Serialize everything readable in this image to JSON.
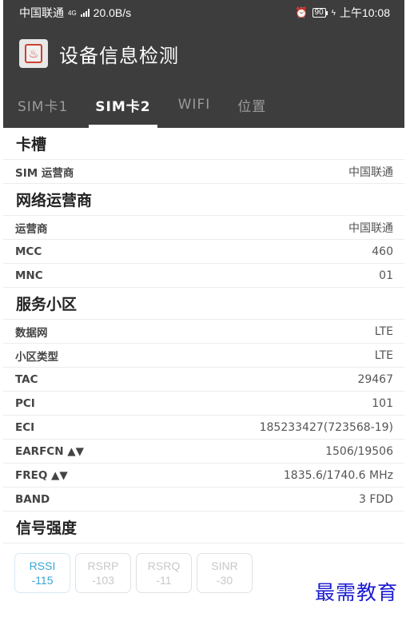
{
  "status_bar": {
    "carrier": "中国联通",
    "net_type": "4G",
    "speed": "20.0B/s",
    "alarm_icon": "alarm-icon",
    "battery": "90",
    "time": "上午10:08"
  },
  "header": {
    "app_icon": "app-icon",
    "title": "设备信息检测"
  },
  "tabs": [
    {
      "label": "SIM卡1"
    },
    {
      "label": "SIM卡2"
    },
    {
      "label": "WIFI"
    },
    {
      "label": "位置"
    }
  ],
  "active_tab": 1,
  "sections": [
    {
      "title": "卡槽",
      "rows": [
        {
          "key": "SIM 运营商",
          "value": "中国联通"
        }
      ]
    },
    {
      "title": "网络运营商",
      "rows": [
        {
          "key": "运营商",
          "value": "中国联通"
        },
        {
          "key": "MCC",
          "value": "460"
        },
        {
          "key": "MNC",
          "value": "01"
        }
      ]
    },
    {
      "title": "服务小区",
      "rows": [
        {
          "key": "数据网",
          "value": "LTE"
        },
        {
          "key": "小区类型",
          "value": "LTE"
        },
        {
          "key": "TAC",
          "value": "29467"
        },
        {
          "key": "PCI",
          "value": "101"
        },
        {
          "key": "ECI",
          "value": "185233427(723568-19)"
        },
        {
          "key": "EARFCN ▲▼",
          "value": "1506/19506"
        },
        {
          "key": "FREQ ▲▼",
          "value": "1835.6/1740.6 MHz"
        },
        {
          "key": "BAND",
          "value": "3 FDD"
        }
      ]
    },
    {
      "title": "信号强度",
      "rows": []
    }
  ],
  "signal_chips": [
    {
      "name": "RSSI",
      "value": "-115",
      "active": true
    },
    {
      "name": "RSRP",
      "value": "-103",
      "active": false
    },
    {
      "name": "RSRQ",
      "value": "-11",
      "active": false
    },
    {
      "name": "SINR",
      "value": "-30",
      "active": false
    }
  ],
  "watermark": "最需教育",
  "colors": {
    "bar_bg": "#3d3d3d",
    "accent_blue": "#39a5d8",
    "watermark": "#1b1bd0"
  }
}
